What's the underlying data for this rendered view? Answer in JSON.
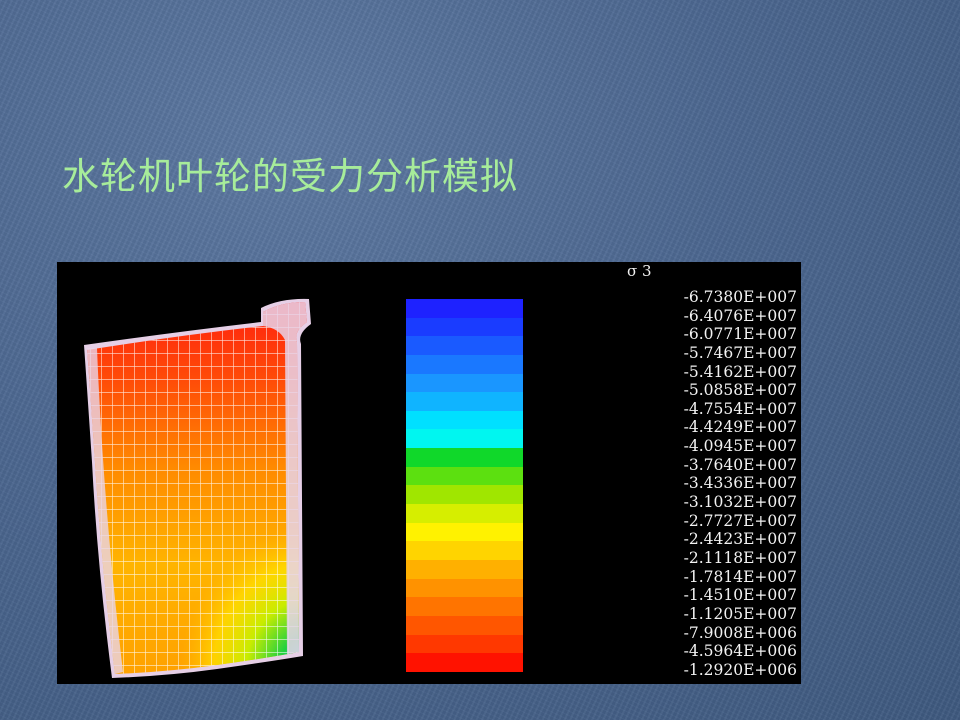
{
  "slide": {
    "title": "水轮机叶轮的受力分析模拟"
  },
  "figure": {
    "legend_title": "σ 3",
    "legend_values": [
      "-6.7380E+007",
      "-6.4076E+007",
      "-6.0771E+007",
      "-5.7467E+007",
      "-5.4162E+007",
      "-5.0858E+007",
      "-4.7554E+007",
      "-4.4249E+007",
      "-4.0945E+007",
      "-3.7640E+007",
      "-3.4336E+007",
      "-3.1032E+007",
      "-2.7727E+007",
      "-2.4423E+007",
      "-2.1118E+007",
      "-1.7814E+007",
      "-1.4510E+007",
      "-1.1205E+007",
      "-7.9008E+006",
      "-4.5964E+006",
      "-1.2920E+006"
    ],
    "colorbar_colors": [
      "#1e22ff",
      "#1a3cff",
      "#1a5aff",
      "#1a78ff",
      "#1a96ff",
      "#10b4ff",
      "#00e0ff",
      "#00f6f0",
      "#10d82a",
      "#5ce010",
      "#a0e600",
      "#d6ee00",
      "#fff200",
      "#ffd400",
      "#ffb000",
      "#ff9200",
      "#ff7400",
      "#ff5600",
      "#ff3800",
      "#ff1200"
    ]
  }
}
